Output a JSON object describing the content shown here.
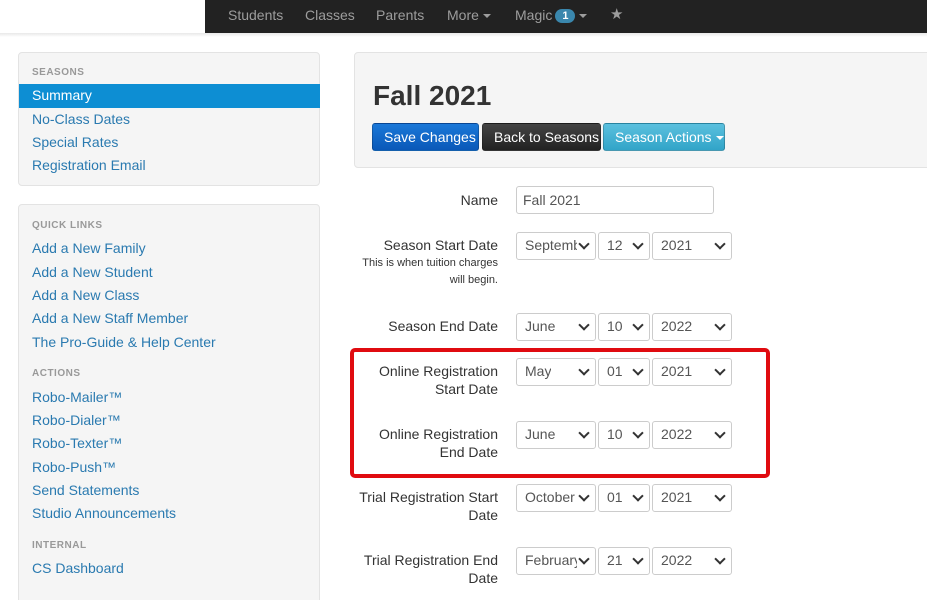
{
  "topnav": {
    "items": [
      "Students",
      "Classes",
      "Parents",
      "More",
      "Magic"
    ],
    "magic_badge": "1",
    "star_icon": "star-icon"
  },
  "sidebar": {
    "seasons_header": "SEASONS",
    "seasons": [
      "Summary",
      "No-Class Dates",
      "Special Rates",
      "Registration Email"
    ],
    "quick_links_header": "QUICK LINKS",
    "quick_links": [
      "Add a New Family",
      "Add a New Student",
      "Add a New Class",
      "Add a New Staff Member",
      "The Pro-Guide & Help Center"
    ],
    "actions_header": "ACTIONS",
    "actions": [
      "Robo-Mailer™",
      "Robo-Dialer™",
      "Robo-Texter™",
      "Robo-Push™",
      "Send Statements",
      "Studio Announcements"
    ],
    "internal_header": "INTERNAL",
    "internal": [
      "CS Dashboard"
    ]
  },
  "header": {
    "title": "Fall 2021",
    "save": "Save Changes",
    "back": "Back to Seasons",
    "actions": "Season Actions"
  },
  "form": {
    "name_label": "Name",
    "name_value": "Fall 2021",
    "rows": [
      {
        "label": "Season Start Date",
        "help": "This is when tuition charges will begin.",
        "month": "September",
        "day": "12",
        "year": "2021"
      },
      {
        "label": "Season End Date",
        "month": "June",
        "day": "10",
        "year": "2022"
      },
      {
        "label": "Online Registration Start Date",
        "month": "May",
        "day": "01",
        "year": "2021"
      },
      {
        "label": "Online Registration End Date",
        "month": "June",
        "day": "10",
        "year": "2022"
      },
      {
        "label": "Trial Registration Start Date",
        "month": "October",
        "day": "01",
        "year": "2021"
      },
      {
        "label": "Trial Registration End Date",
        "month": "February",
        "day": "21",
        "year": "2022"
      }
    ]
  },
  "colors": {
    "highlight": "#e00b10",
    "primary": "#0a62c6",
    "info": "#5bc0de",
    "active": "#0d8ed3"
  }
}
